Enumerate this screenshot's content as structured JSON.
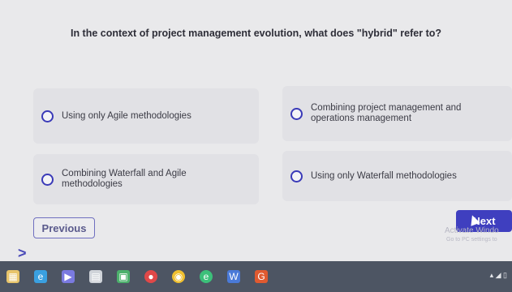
{
  "question": "In the context of project management evolution, what does \"hybrid\" refer to?",
  "options": [
    {
      "label": "Using only Agile methodologies"
    },
    {
      "label": "Combining project management and operations management"
    },
    {
      "label": "Combining Waterfall and Agile methodologies"
    },
    {
      "label": "Using only Waterfall methodologies"
    }
  ],
  "nav": {
    "previous_label": "Previous",
    "next_label": "Next"
  },
  "watermark": {
    "title": "Activate Windo",
    "subtitle": "Go to PC settings to"
  },
  "colors": {
    "accent": "#3f3fbf",
    "radio_border": "#3a3ab8",
    "taskbar": "#4d5563"
  },
  "taskbar": {
    "icons": [
      "start-icon",
      "edge-icon",
      "media-icon",
      "app-icon",
      "store-icon",
      "camera-icon",
      "chrome-icon",
      "edge-new-icon",
      "word-icon",
      "game-icon"
    ]
  }
}
